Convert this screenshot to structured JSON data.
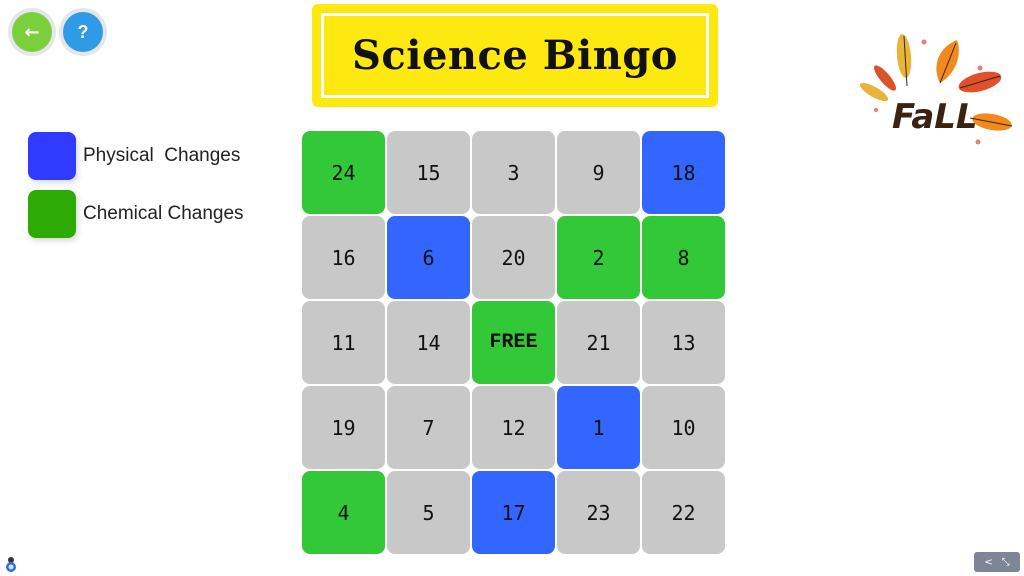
{
  "nav": {
    "back_icon": "←",
    "help_icon": "?"
  },
  "title": "Science Bingo",
  "legend": [
    {
      "label": "Physical  Changes",
      "color": "#2f3bff"
    },
    {
      "label": "Chemical Changes",
      "color": "#2eaa04"
    }
  ],
  "colors": {
    "physical": "#3366ff",
    "chemical": "#33c837",
    "unmarked": "#c8c8c8"
  },
  "board": [
    [
      {
        "v": "24",
        "s": "chemical"
      },
      {
        "v": "15",
        "s": "unmarked"
      },
      {
        "v": "3",
        "s": "unmarked"
      },
      {
        "v": "9",
        "s": "unmarked"
      },
      {
        "v": "18",
        "s": "physical"
      }
    ],
    [
      {
        "v": "16",
        "s": "unmarked"
      },
      {
        "v": "6",
        "s": "physical"
      },
      {
        "v": "20",
        "s": "unmarked"
      },
      {
        "v": "2",
        "s": "chemical"
      },
      {
        "v": "8",
        "s": "chemical"
      }
    ],
    [
      {
        "v": "11",
        "s": "unmarked"
      },
      {
        "v": "14",
        "s": "unmarked"
      },
      {
        "v": "FREE",
        "s": "chemical"
      },
      {
        "v": "21",
        "s": "unmarked"
      },
      {
        "v": "13",
        "s": "unmarked"
      }
    ],
    [
      {
        "v": "19",
        "s": "unmarked"
      },
      {
        "v": "7",
        "s": "unmarked"
      },
      {
        "v": "12",
        "s": "unmarked"
      },
      {
        "v": "1",
        "s": "physical"
      },
      {
        "v": "10",
        "s": "unmarked"
      }
    ],
    [
      {
        "v": "4",
        "s": "chemical"
      },
      {
        "v": "5",
        "s": "unmarked"
      },
      {
        "v": "17",
        "s": "physical"
      },
      {
        "v": "23",
        "s": "unmarked"
      },
      {
        "v": "22",
        "s": "unmarked"
      }
    ]
  ],
  "decoration": {
    "logo_text": "FaLL"
  },
  "bottom_bar": {
    "share_icon": "<",
    "fullscreen_icon": "⤡"
  }
}
